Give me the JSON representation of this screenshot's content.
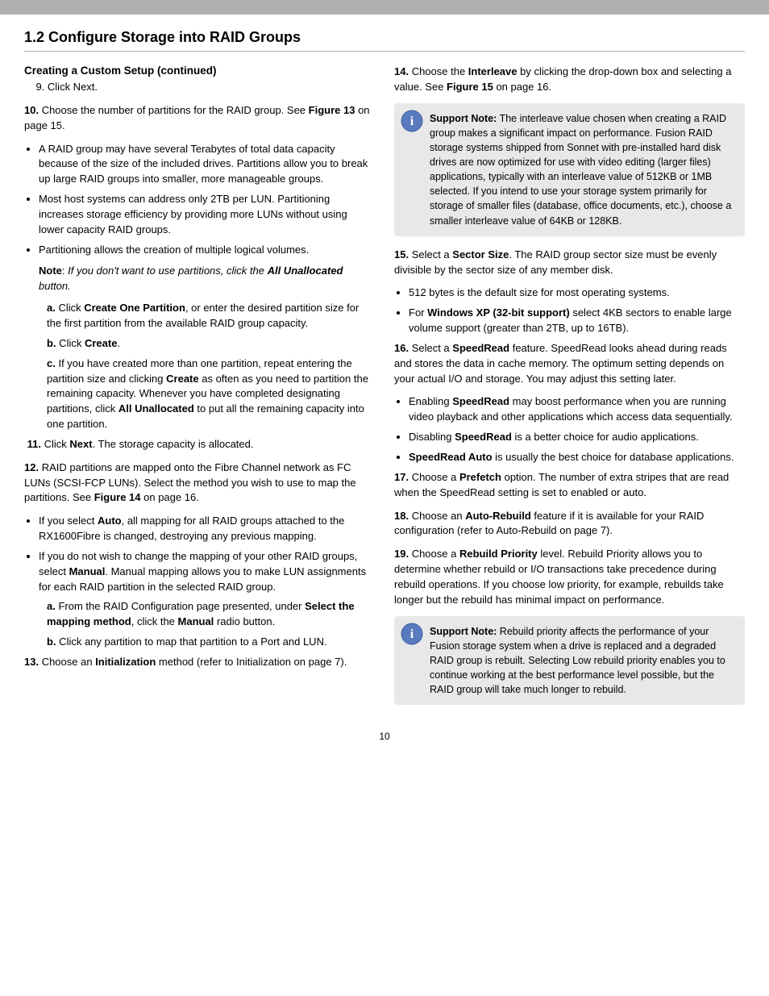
{
  "page": {
    "top_bar": "",
    "main_title": "1.2  Configure Storage into RAID Groups",
    "left_col": {
      "section_title": "Creating a Custom Setup (continued)",
      "step9": "9. Click Next.",
      "step10": {
        "intro": "10. Choose the number of partitions for the RAID group. See Figure 13 on page 15.",
        "bullets": [
          "A RAID group may have several Terabytes of total data capacity because of the size of the included drives. Partitions allow you to break up large RAID groups into smaller, more manageable groups.",
          "Most host systems can address only 2TB per LUN. Partitioning increases storage efficiency by providing more LUNs without using lower capacity RAID groups.",
          "Partitioning allows the creation of multiple logical volumes."
        ]
      },
      "note_block": "Note: If you don't want to use partitions, click the All Unallocated button.",
      "step_a1": {
        "label": "a.",
        "text": "Click Create One Partition, or enter the desired partition size for the first partition from the available RAID group capacity."
      },
      "step_b1": {
        "label": "b.",
        "text": "Click Create."
      },
      "step_c1": {
        "label": "c.",
        "text": "If you have created more than one partition, repeat entering the partition size and clicking Create as often as you need to partition the remaining capacity. Whenever you have completed designating partitions, click All Unallocated to put all the remaining capacity into one partition."
      },
      "step11": "11. Click Next. The storage capacity is allocated.",
      "step12": {
        "intro": "12. RAID partitions are mapped onto the Fibre Channel network as FC LUNs (SCSI-FCP LUNs). Select the method you wish to use to map the partitions. See Figure 14 on page 16.",
        "bullets": [
          "If you select Auto, all mapping for all RAID groups attached to the RX1600Fibre is changed, destroying any previous mapping.",
          "If you do not wish to change the mapping of your other RAID groups, select Manual. Manual mapping allows you to make LUN assignments for each RAID partition in the selected RAID group."
        ]
      },
      "step_a2": {
        "label": "a.",
        "text": "From the RAID Configuration page presented, under Select the mapping method, click the Manual radio button."
      },
      "step_b2": {
        "label": "b.",
        "text": "Click any partition to map that partition to a Port and LUN."
      },
      "step13": {
        "intro": "13. Choose an Initialization method (refer to Initialization on page 7)."
      }
    },
    "right_col": {
      "step14": {
        "intro": "14. Choose the Interleave by clicking the drop-down box and selecting a value. See Figure 15 on page 16."
      },
      "support_box1": {
        "title": "Support Note:",
        "text": "The interleave value chosen when creating a RAID group makes a significant impact on performance. Fusion RAID storage systems shipped from Sonnet with pre-installed hard disk drives are now optimized for use with video editing (larger files) applications, typically with an interleave value of 512KB or 1MB selected. If you intend to use your storage system primarily for storage of smaller files (database, office documents, etc.), choose a smaller interleave value of 64KB or 128KB."
      },
      "step15": {
        "intro": "15. Select a Sector Size. The RAID group sector size must be evenly divisible by the sector size of any member disk.",
        "bullets": [
          "512 bytes is the default size for most operating systems.",
          "For Windows XP (32-bit support) select 4KB sectors to enable large volume support (greater than 2TB, up to 16TB)."
        ]
      },
      "step16": {
        "intro": "16. Select a SpeedRead feature. SpeedRead looks ahead during reads and stores the data in cache memory. The optimum setting depends on your actual I/O and storage. You may adjust this setting later.",
        "bullets": [
          "Enabling SpeedRead may boost performance when you are running video playback and other applications which access data sequentially.",
          "Disabling SpeedRead is a better choice for audio applications.",
          "SpeedRead Auto is usually the best choice for database applications."
        ]
      },
      "step17": {
        "intro": "17. Choose a Prefetch option. The number of extra stripes that are read when the SpeedRead setting is set to enabled or auto."
      },
      "step18": {
        "intro": "18. Choose an Auto-Rebuild feature if it is available for your RAID configuration (refer to Auto-Rebuild on page 7)."
      },
      "step19": {
        "intro": "19. Choose a Rebuild Priority level. Rebuild Priority allows you to determine whether rebuild or I/O transactions take precedence during rebuild operations. If you choose low priority, for example, rebuilds take longer but the rebuild has minimal impact on performance."
      },
      "support_box2": {
        "title": "Support Note:",
        "text": "Rebuild priority affects the performance of your Fusion storage system when a drive is replaced and a degraded RAID group is rebuilt. Selecting Low rebuild priority enables you to continue working at the best performance level possible, but the RAID group will take much longer to rebuild."
      }
    },
    "page_number": "10"
  }
}
